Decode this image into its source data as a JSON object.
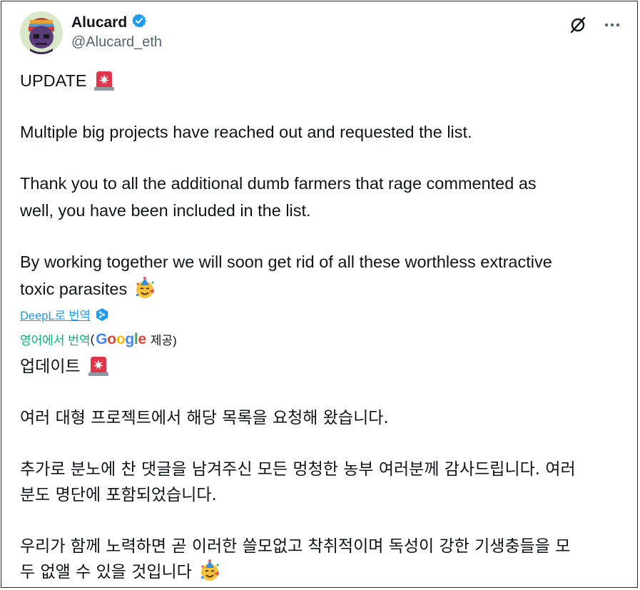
{
  "author": {
    "name": "Alucard",
    "handle": "@Alucard_eth"
  },
  "icons": {
    "verified": "verified-badge-icon",
    "grok": "grok-icon",
    "more": "more-options-icon",
    "siren": "siren-emoji-icon",
    "party": "party-face-emoji-icon",
    "deepl": "deepl-logo-icon"
  },
  "tweet": {
    "en": {
      "p1": "UPDATE",
      "p2": "Multiple big projects have reached out and requested the list.",
      "p3a": "Thank you to all the additional dumb farmers that rage commented as",
      "p3b": "well, you have been included in the list.",
      "p4a": "By working together we will soon get rid of all these worthless extractive",
      "p4b": "toxic parasites"
    },
    "translate": {
      "deepl_link": "DeepL로 번역",
      "google_label": "영어에서 번역",
      "paren_open": "(",
      "google_logo": "Google",
      "provider_suffix": "제공)"
    },
    "ko": {
      "p1": "업데이트",
      "p2": "여러 대형 프로젝트에서 해당 목록을 요청해 왔습니다.",
      "p3a": "추가로 분노에 찬 댓글을 남겨주신 모든 멍청한 농부 여러분께 감사드립니다. 여러",
      "p3b": "분도 명단에 포함되었습니다.",
      "p4a": "우리가 함께 노력하면 곧 이러한 쓸모없고 착취적이며 독성이 강한 기생충들을 모",
      "p4b": "두 없앨 수 있을 것입니다"
    }
  },
  "colors": {
    "accent": "#1d9bf0",
    "google_translate_label": "#00ba7c",
    "secondary_text": "#536471"
  }
}
